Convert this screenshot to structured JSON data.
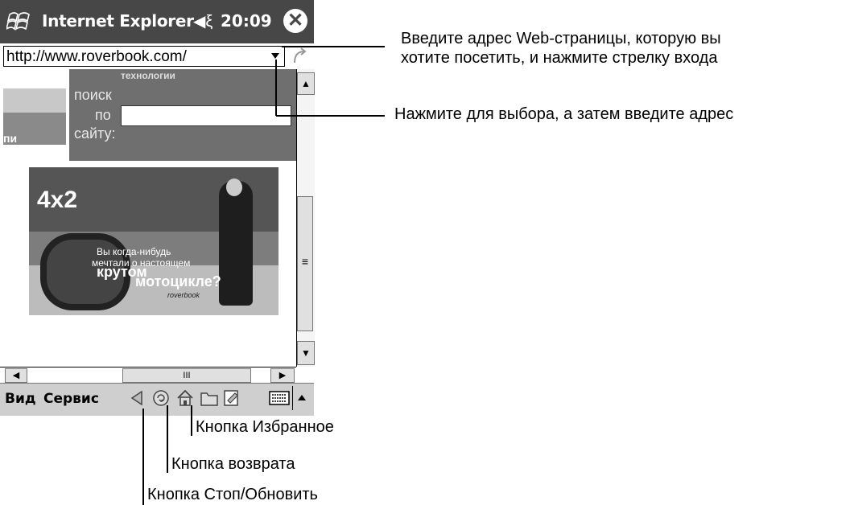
{
  "titlebar": {
    "app_title": "Internet Explorer",
    "time": "20:09",
    "speaker_icon": "speaker-icon",
    "close_icon": "close-icon"
  },
  "address_bar": {
    "value": "http://www.roverbook.com/",
    "dropdown_icon": "chevron-down-icon",
    "go_icon": "go-arrow-icon"
  },
  "page": {
    "header_text": "технологии",
    "side_text": "пи",
    "search_line1": "поиск",
    "search_line2": "по",
    "search_line3": "сайту:",
    "search_value": "",
    "banner_title": "4x2",
    "banner_slogan1": "Вы когда-нибудь",
    "banner_slogan2": "мечтали о настоящем",
    "banner_slogan3": "крутом",
    "banner_slogan4": "мотоцикле?",
    "banner_brand": "roverbook"
  },
  "scrollbars": {
    "v_up": "▲",
    "v_thumb": "≡",
    "v_down": "▼",
    "h_left": "◀",
    "h_thumb": "III",
    "h_right": "▶"
  },
  "menubar": {
    "view": "Вид",
    "tools": "Сервис",
    "icons": [
      "back-icon",
      "stop-refresh-icon",
      "home-icon",
      "favorites-icon",
      "edit-icon"
    ],
    "keyboard_icon": "keyboard-icon"
  },
  "annotations": {
    "address_hint_line1": "Введите адрес Web-страницы, которую вы",
    "address_hint_line2": "хотите посетить, и нажмите стрелку входа",
    "dropdown_hint": "Нажмите для выбора, а затем введите адрес",
    "favorites_label": "Кнопка Избранное",
    "home_label": "Кнопка возврата",
    "stop_refresh_label": "Кнопка Стоп/Обновить"
  }
}
